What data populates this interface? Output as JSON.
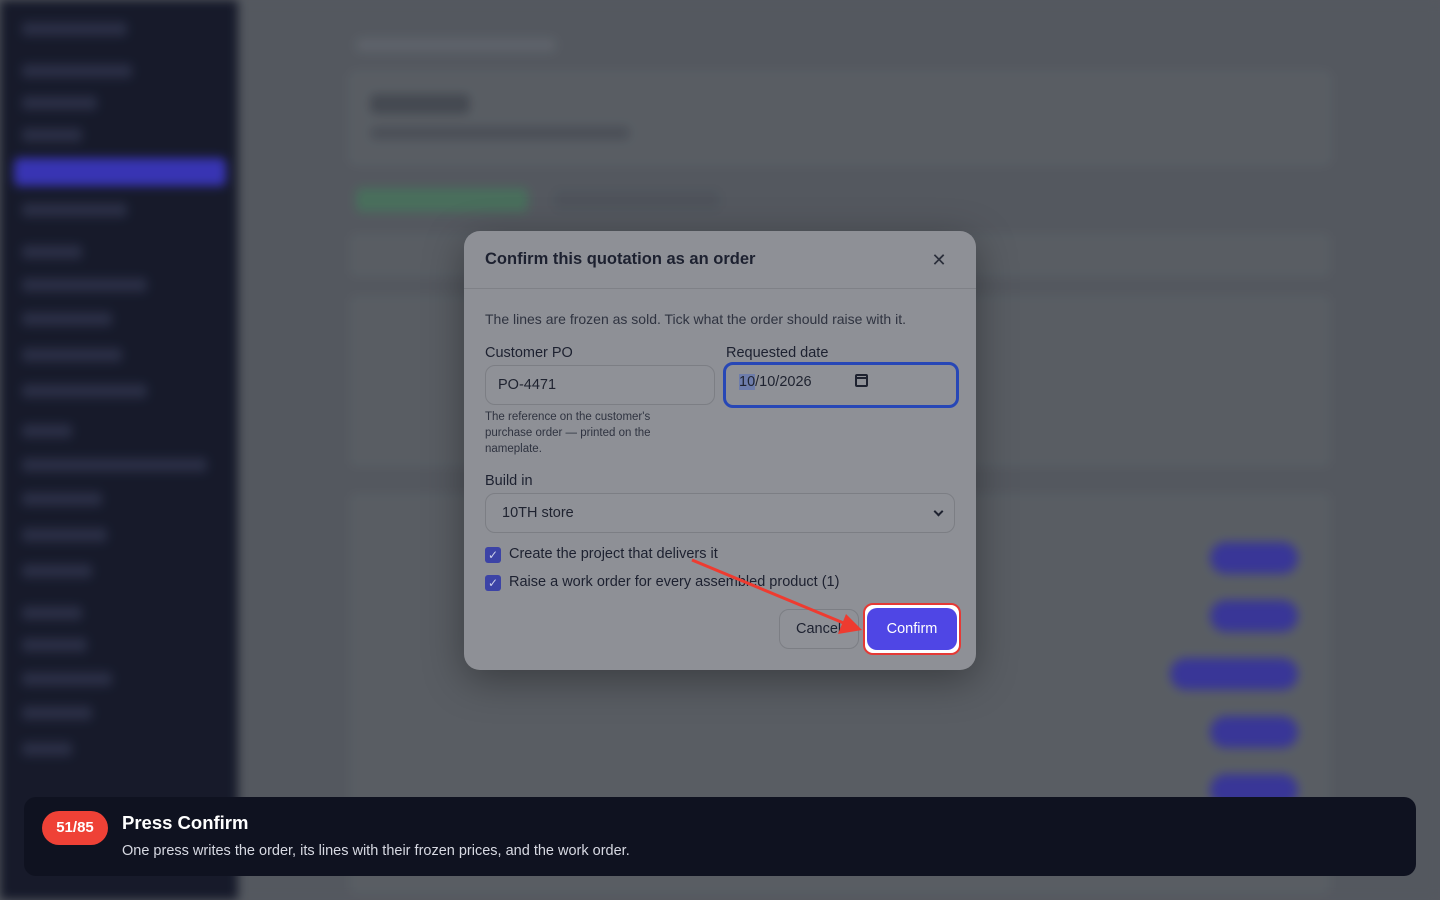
{
  "modal": {
    "title": "Confirm this quotation as an order",
    "close_icon": "close-icon",
    "intro": "The lines are frozen as sold. Tick what the order should raise with it.",
    "customer_po": {
      "label": "Customer PO",
      "value": "PO-4471",
      "help": "The reference on the customer's purchase order — printed on the nameplate."
    },
    "requested_date": {
      "label": "Requested date",
      "month": "10",
      "rest": "/10/2026",
      "icon": "calendar-icon"
    },
    "build_in": {
      "label": "Build in",
      "selected": "10TH store"
    },
    "checkboxes": [
      {
        "label": "Create the project that delivers it",
        "checked": true
      },
      {
        "label": "Raise a work order for every assembled product (1)",
        "checked": true
      }
    ],
    "cancel_label": "Cancel",
    "confirm_label": "Confirm"
  },
  "tour": {
    "step": "51/85",
    "title": "Press Confirm",
    "description": "One press writes the order, its lines with their frozen prices, and the work order."
  },
  "colors": {
    "accent": "#4f46e5",
    "highlight": "#e53935",
    "tour_badge": "#ef4136",
    "tour_bg": "#0f1220"
  }
}
